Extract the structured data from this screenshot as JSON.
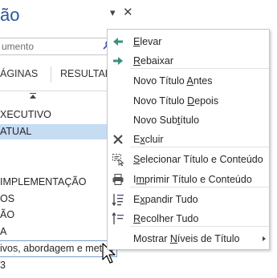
{
  "pane": {
    "title": "ão",
    "dropdown_glyph": "▾",
    "close_glyph": "✕",
    "search": {
      "placeholder": "umento"
    },
    "tabs": [
      "ÁGINAS",
      "RESULTAD"
    ],
    "outline": [
      {
        "text": "XECUTIVO",
        "selected": false
      },
      {
        "text": " ATUAL",
        "selected": true
      },
      {
        "text": "",
        "selected": false
      },
      {
        "text": "",
        "selected": false
      },
      {
        "text": " IMPLEMENTAÇÃO",
        "selected": false
      },
      {
        "text": "OS",
        "selected": false
      },
      {
        "text": "ÃO",
        "selected": false
      },
      {
        "text": "A",
        "selected": false
      }
    ],
    "edit_text": "ivos, abordagem e metod",
    "bottom_text": "3"
  },
  "context_menu": {
    "items": [
      {
        "pre": "",
        "acc": "E",
        "post": "levar",
        "icon": "arrow-left-icon"
      },
      {
        "pre": "",
        "acc": "R",
        "post": "ebaixar",
        "icon": "arrow-right-icon"
      },
      {
        "pre": "Novo Título ",
        "acc": "A",
        "post": "ntes",
        "icon": ""
      },
      {
        "pre": "Novo Título ",
        "acc": "D",
        "post": "epois",
        "icon": ""
      },
      {
        "pre": "Novo Sub",
        "acc": "t",
        "post": "ítulo",
        "icon": ""
      },
      {
        "pre": "E",
        "acc": "x",
        "post": "cluir",
        "icon": "delete-x-icon"
      },
      {
        "pre": "",
        "acc": "S",
        "post": "elecionar Título e Conteúdo",
        "icon": "select-heading-icon"
      },
      {
        "pre": "I",
        "acc": "m",
        "post": "primir Título e Conteúdo",
        "icon": "printer-icon"
      },
      {
        "pre": "E",
        "acc": "x",
        "post": "pandir Tudo",
        "icon": "expand-all-icon"
      },
      {
        "pre": "",
        "acc": "R",
        "post": "ecolher Tudo",
        "icon": "collapse-all-icon"
      },
      {
        "pre": "Mostrar ",
        "acc": "N",
        "post": "íveis de Título",
        "icon": ""
      }
    ]
  },
  "colors": {
    "accent": "#2b579a",
    "selection": "#c5dcf3",
    "arrow_green": "#3c8f7c"
  }
}
